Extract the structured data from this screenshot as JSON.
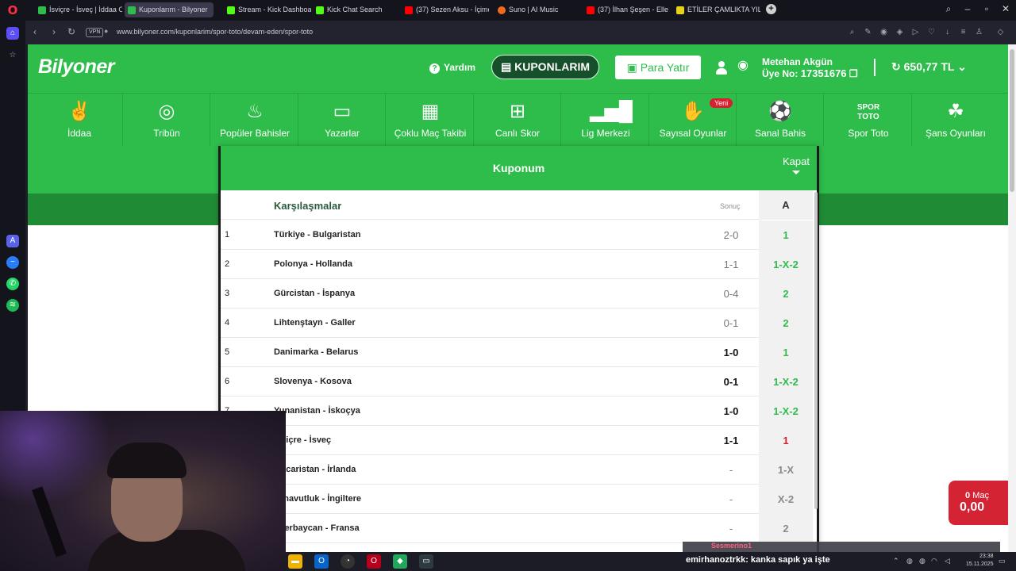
{
  "browser": {
    "tabs": [
      {
        "label": "İsviçre - İsveç | İddaa Oran",
        "color": "#2ebd4b"
      },
      {
        "label": "Kuponlarım - Bilyoner",
        "color": "#2ebd4b"
      },
      {
        "label": "Stream - Kick Dashboard",
        "color": "#53fc18"
      },
      {
        "label": "Kick Chat Search",
        "color": "#53fc18"
      },
      {
        "label": "(37) Sezen Aksu - İçime Si",
        "color": "#ff0000"
      },
      {
        "label": "Suno | AI Music",
        "color": "#f26b1d"
      },
      {
        "label": "(37) İlhan Şeşen - Elle",
        "color": "#ff0000"
      },
      {
        "label": "ETİLER ÇAMLIKTA YILMAZ",
        "color": "#e6d21a"
      }
    ],
    "url": "www.bilyoner.com/kuponlarim/spor-toto/devam-eden/spor-toto",
    "vpn": "VPN"
  },
  "site": {
    "logo": "Bilyoner",
    "help": "Yardım",
    "coupons_button": "KUPONLARIM",
    "deposit_button": "Para Yatır",
    "user_name": "Metehan Akgün",
    "member_label": "Üye No:",
    "member_no": "17351676",
    "balance": "650,77 TL",
    "nav": [
      {
        "label": "İddaa",
        "icon": "iddaa-icon"
      },
      {
        "label": "Tribün",
        "icon": "tribun-icon"
      },
      {
        "label": "Popüler Bahisler",
        "icon": "flame-icon"
      },
      {
        "label": "Yazarlar",
        "icon": "chat-icon"
      },
      {
        "label": "Çoklu Maç Takibi",
        "icon": "grid-icon"
      },
      {
        "label": "Canlı Skor",
        "icon": "scoreboard-icon"
      },
      {
        "label": "Lig Merkezi",
        "icon": "bar-chart-icon"
      },
      {
        "label": "Sayısal Oyunlar",
        "icon": "lottery-icon"
      },
      {
        "label": "Sanal Bahis",
        "icon": "player-icon"
      },
      {
        "label": "Spor Toto",
        "icon": "spor-toto-icon"
      },
      {
        "label": "Şans Oyunları",
        "icon": "clover-icon"
      }
    ],
    "new_badge": "Yeni"
  },
  "coupon": {
    "title": "Kuponum",
    "close": "Kapat",
    "col_match": "Karşılaşmalar",
    "col_result": "Sonuç",
    "col_pick": "A",
    "rows": [
      {
        "no": "1",
        "match": "Türkiye - Bulgaristan",
        "result": "2-0",
        "pick": "1",
        "pick_color": "#2ebd4b",
        "bold": false
      },
      {
        "no": "2",
        "match": "Polonya - Hollanda",
        "result": "1-1",
        "pick": "1-X-2",
        "pick_color": "#2ebd4b",
        "bold": false
      },
      {
        "no": "3",
        "match": "Gürcistan - İspanya",
        "result": "0-4",
        "pick": "2",
        "pick_color": "#2ebd4b",
        "bold": false
      },
      {
        "no": "4",
        "match": "Lihtenştayn - Galler",
        "result": "0-1",
        "pick": "2",
        "pick_color": "#2ebd4b",
        "bold": false
      },
      {
        "no": "5",
        "match": "Danimarka - Belarus",
        "result": "1-0",
        "pick": "1",
        "pick_color": "#2ebd4b",
        "bold": true
      },
      {
        "no": "6",
        "match": "Slovenya - Kosova",
        "result": "0-1",
        "pick": "1-X-2",
        "pick_color": "#2ebd4b",
        "bold": true
      },
      {
        "no": "7",
        "match": "Yunanistan - İskoçya",
        "result": "1-0",
        "pick": "1-X-2",
        "pick_color": "#2ebd4b",
        "bold": true
      },
      {
        "no": "",
        "match": "İsviçre - İsveç",
        "result": "1-1",
        "pick": "1",
        "pick_color": "#d62030",
        "bold": true
      },
      {
        "no": "",
        "match": "Macaristan - İrlanda",
        "result": "-",
        "pick": "1-X",
        "pick_color": "#8a8a8a",
        "bold": false
      },
      {
        "no": "",
        "match": "Arnavutluk - İngiltere",
        "result": "-",
        "pick": "X-2",
        "pick_color": "#8a8a8a",
        "bold": false
      },
      {
        "no": "",
        "match": "Azerbaycan - Fransa",
        "result": "-",
        "pick": "2",
        "pick_color": "#8a8a8a",
        "bold": false
      }
    ]
  },
  "betslip": {
    "count": "0",
    "count_label": "Maç",
    "amount": "0,00"
  },
  "taskbar": {
    "chat_user": "emirhanoztrkk",
    "chat_message": ": kanka sapık ya işte",
    "time": "23:38",
    "date": "15.11.2025",
    "banner": "Sesmerino1"
  }
}
